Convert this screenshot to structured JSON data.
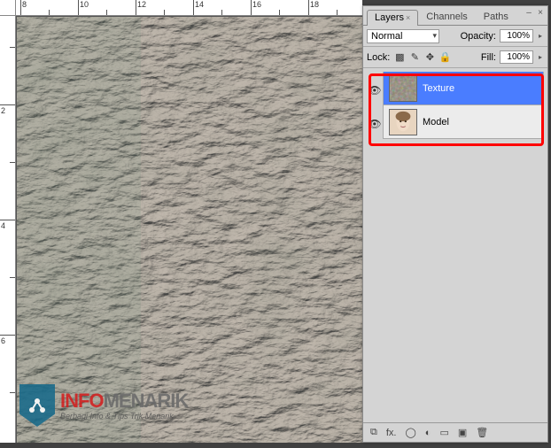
{
  "ruler_h": [
    "8",
    "10",
    "12",
    "14",
    "16",
    "18"
  ],
  "ruler_v": [
    "2",
    "4",
    "6"
  ],
  "panel": {
    "tabs": {
      "layers": "Layers",
      "channels": "Channels",
      "paths": "Paths"
    },
    "blend_mode": "Normal",
    "opacity_label": "Opacity:",
    "opacity_value": "100%",
    "lock_label": "Lock:",
    "fill_label": "Fill:",
    "fill_value": "100%",
    "layers": [
      {
        "name": "Texture"
      },
      {
        "name": "Model"
      }
    ],
    "minimize": "–",
    "close": "×",
    "menu": "▸"
  },
  "footer_icons": {
    "link": "⧉",
    "fx": "fx.",
    "mask": "◯",
    "adj": "◐",
    "folder": "▭",
    "new": "▣",
    "trash": "🗑"
  },
  "watermark": {
    "t1": "INFO",
    "t2": "MENARIK",
    "tag": "Berbagi Info & Tips Trik Menarik"
  }
}
